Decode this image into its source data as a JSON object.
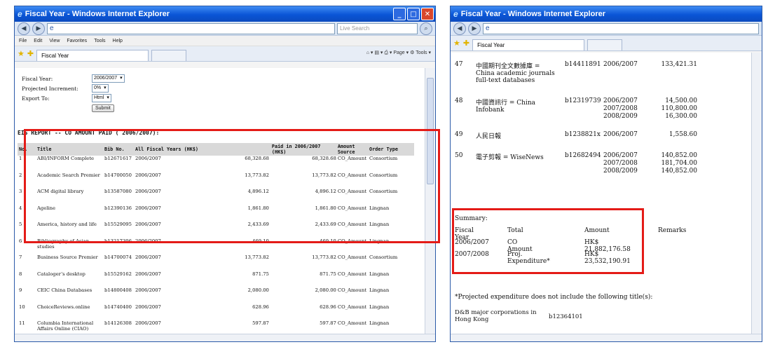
{
  "left_window": {
    "title": "Fiscal Year - Windows Internet Explorer",
    "address_icon": "ie-page-icon",
    "live_search_placeholder": "Live Search",
    "menu": [
      "File",
      "Edit",
      "View",
      "Favorites",
      "Tools",
      "Help"
    ],
    "tab": "Fiscal Year",
    "toolbar_right": "⌂ ▾ ▤ ▾ ⎙ ▾ Page ▾ ⚙ Tools ▾",
    "form": {
      "fiscal_year_label": "Fiscal Year:",
      "fiscal_year_value": "2006/2007",
      "increment_label": "Projected Increment:",
      "increment_value": "0%",
      "export_label": "Export To:",
      "export_value": "Html",
      "submit": "Submit"
    },
    "report_title": "EIS REPORT -- CO AMOUNT PAID ( 2006/2007):",
    "columns": [
      "No.",
      "Title",
      "Bib No.",
      "All Fiscal Years (HK$)",
      "Paid in 2006/2007 (HK$)",
      "Amount Source",
      "Order Type"
    ],
    "rows": [
      [
        "1",
        "ABI/INFORM Complete",
        "b12671617",
        "2006/2007",
        "68,328.68",
        "68,328.68",
        "CO_Amount",
        "Consortium"
      ],
      [
        "2",
        "Academic Search Premier",
        "b14700050",
        "2006/2007",
        "13,773.82",
        "13,773.82",
        "CO_Amount",
        "Consortium"
      ],
      [
        "3",
        "ACM digital library",
        "b13587080",
        "2006/2007",
        "4,896.12",
        "4,896.12",
        "CO_Amount",
        "Consortium"
      ],
      [
        "4",
        "Ageline",
        "b12390136",
        "2006/2007",
        "1,861.80",
        "1,861.80",
        "CO_Amount",
        "Lingnan"
      ],
      [
        "5",
        "America, history and life",
        "b15529095",
        "2006/2007",
        "2,433.69",
        "2,433.69",
        "CO_Amount",
        "Lingnan"
      ],
      [
        "6",
        "Bibliography of Asian studies",
        "b13217306",
        "2006/2007",
        "469.10",
        "469.10",
        "CO_Amount",
        "Lingnan"
      ],
      [
        "7",
        "Business Source Premier",
        "b14700074",
        "2006/2007",
        "13,773.82",
        "13,773.82",
        "CO_Amount",
        "Consortium"
      ],
      [
        "8",
        "Catalogerʼs desktop",
        "b15529162",
        "2006/2007",
        "871.75",
        "871.75",
        "CO_Amount",
        "Lingnan"
      ],
      [
        "9",
        "CEIC China Databases",
        "b14800408",
        "2006/2007",
        "2,080.00",
        "2,080.00",
        "CO_Amount",
        "Lingnan"
      ],
      [
        "10",
        "ChoiceReviews.online",
        "b14740400",
        "2006/2007",
        "628.96",
        "628.96",
        "CO_Amount",
        "Lingnan"
      ],
      [
        "11",
        "Columbia International Affairs Online (CIAO)",
        "b14126308",
        "2006/2007",
        "597.87",
        "597.87",
        "CO_Amount",
        "Lingnan"
      ]
    ]
  },
  "right_window": {
    "title": "Fiscal Year - Windows Internet Explorer",
    "tab": "Fiscal Year",
    "items": [
      {
        "no": "47",
        "title": "中國期刊全文數據庫 = China academic journals full-text databases",
        "bib": "b14411891",
        "years": [
          "2006/2007"
        ],
        "amounts": [
          "133,421.31"
        ]
      },
      {
        "no": "48",
        "title": "中國資訊行 = China Infobank",
        "bib": "b12319739",
        "years": [
          "2006/2007",
          "2007/2008",
          "2008/2009"
        ],
        "amounts": [
          "14,500.00",
          "110,800.00",
          "16,300.00"
        ]
      },
      {
        "no": "49",
        "title": "人民日報",
        "bib": "b1238821x",
        "years": [
          "2006/2007"
        ],
        "amounts": [
          "1,558.60"
        ]
      },
      {
        "no": "50",
        "title": "電子剪報 = WiseNews",
        "bib": "b12682494",
        "years": [
          "2006/2007",
          "2007/2008",
          "2008/2009"
        ],
        "amounts": [
          "140,852.00",
          "181,704.00",
          "140,852.00"
        ]
      }
    ],
    "summary": {
      "heading": "Summary:",
      "headers": [
        "Fiscal Year",
        "Total",
        "Amount",
        "Remarks"
      ],
      "rows": [
        [
          "2006/2007",
          "CO Amount",
          "HK$ 21,882,176.58",
          ""
        ],
        [
          "2007/2008",
          "Proj. Expenditure*",
          "HK$ 23,532,190.91",
          ""
        ]
      ]
    },
    "footnote": "*Projected expenditure does not include the following title(s):",
    "excluded_title": "D&B major corporations in Hong Kong",
    "excluded_bib": "b12364101"
  },
  "colors": {
    "highlight": "#e41b17",
    "titlebar": "#0a55d6"
  }
}
